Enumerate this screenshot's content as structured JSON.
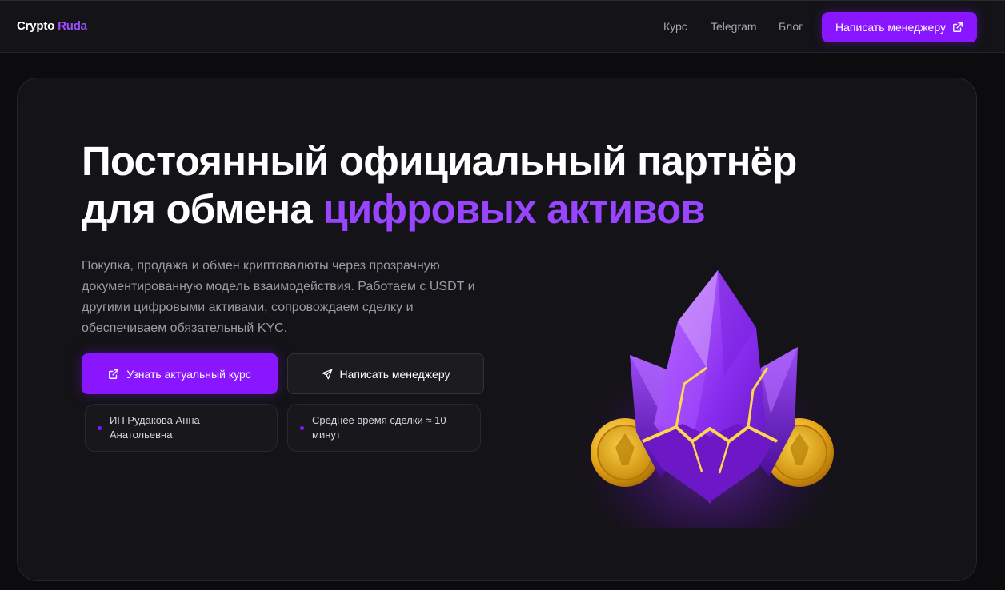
{
  "header": {
    "logo_part1": "Crypto",
    "logo_part2": "Ruda",
    "nav": [
      "Курс",
      "Telegram",
      "Блог"
    ],
    "cta_label": "Написать менеджеру"
  },
  "hero": {
    "title_line1": "Постоянный официальный партнёр",
    "title_line2_plain": "для обмена ",
    "title_line2_accent": "цифровых активов",
    "lead": "Покупка, продажа и обмен криптовалюты через прозрачную документированную модель взаимодействия. Работаем с USDT и другими цифровыми активами, сопровождаем сделку и обеспечиваем обязательный KYC.",
    "primary_button": "Узнать актуальный курс",
    "secondary_button": "Написать менеджеру",
    "info_cards": [
      "ИП Рудакова Анна Анатольевна",
      "Среднее время сделки ≈ 10 минут"
    ]
  },
  "colors": {
    "accent": "#8a16ff",
    "accent_text": "#9945ff",
    "background": "#0c0c0f",
    "card": "#141317"
  },
  "icons": {
    "external_link": "external-link-icon",
    "send": "send-icon",
    "crystal": "crystal-coins-illustration"
  }
}
